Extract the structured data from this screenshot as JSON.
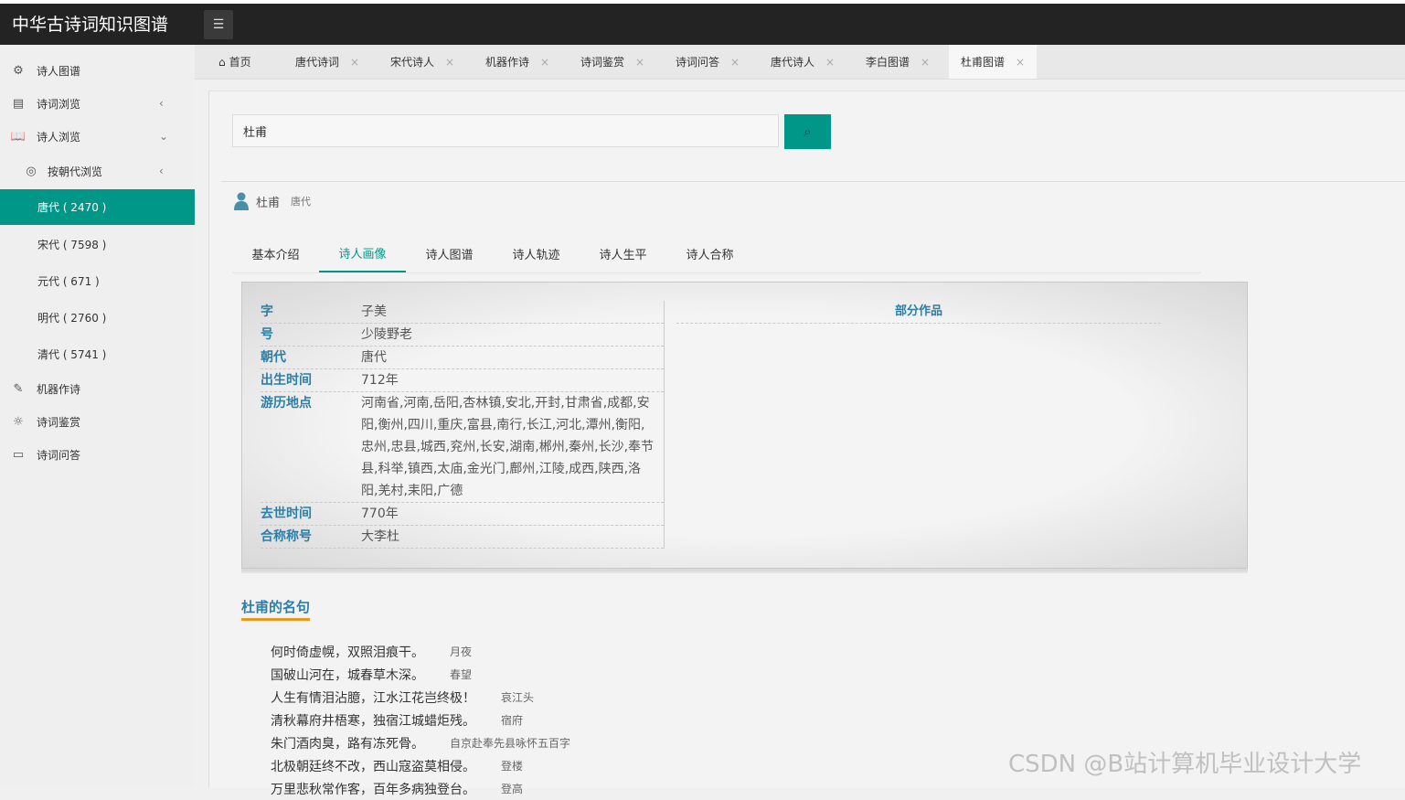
{
  "app": {
    "title": "中华古诗词知识图谱"
  },
  "icons": {
    "menu": "menu-icon",
    "search": "search-icon"
  },
  "sidebar": {
    "items": [
      {
        "label": "诗人图谱",
        "icon": "network-icon"
      },
      {
        "label": "诗词浏览",
        "icon": "document-icon",
        "chevron": "‹"
      },
      {
        "label": "诗人浏览",
        "icon": "book-icon",
        "chevron": "⌄"
      },
      {
        "label": "按朝代浏览",
        "icon": "user-circle-icon",
        "chevron": "‹"
      },
      {
        "label": "唐代 ( 2470 )",
        "active": true
      },
      {
        "label": "宋代 ( 7598 )"
      },
      {
        "label": "元代 ( 671 )"
      },
      {
        "label": "明代 ( 2760 )"
      },
      {
        "label": "清代 ( 5741 )"
      },
      {
        "label": "机器作诗",
        "icon": "pen-icon"
      },
      {
        "label": "诗词鉴赏",
        "icon": "lightbulb-icon"
      },
      {
        "label": "诗词问答",
        "icon": "chat-icon"
      }
    ]
  },
  "tabs": [
    {
      "label": "首页",
      "home": true
    },
    {
      "label": "唐代诗词",
      "close": "×"
    },
    {
      "label": "宋代诗人",
      "close": "×"
    },
    {
      "label": "机器作诗",
      "close": "×"
    },
    {
      "label": "诗词鉴赏",
      "close": "×"
    },
    {
      "label": "诗词问答",
      "close": "×"
    },
    {
      "label": "唐代诗人",
      "close": "×"
    },
    {
      "label": "李白图谱",
      "close": "×"
    },
    {
      "label": "杜甫图谱",
      "close": "×",
      "active": true
    }
  ],
  "search": {
    "value": "杜甫"
  },
  "poet": {
    "name": "杜甫",
    "dynasty": "唐代"
  },
  "poet_tabs": [
    {
      "label": "基本介绍"
    },
    {
      "label": "诗人画像",
      "active": true
    },
    {
      "label": "诗人图谱"
    },
    {
      "label": "诗人轨迹"
    },
    {
      "label": "诗人生平"
    },
    {
      "label": "诗人合称"
    }
  ],
  "info": [
    {
      "key": "字",
      "value": "子美"
    },
    {
      "key": "号",
      "value": "少陵野老"
    },
    {
      "key": "朝代",
      "value": "唐代"
    },
    {
      "key": "出生时间",
      "value": "712年"
    },
    {
      "key": "游历地点",
      "value": "河南省,河南,岳阳,杏林镇,安北,开封,甘肃省,成都,安阳,衡州,四川,重庆,富县,南行,长江,河北,潭州,衡阳,忠州,忠县,城西,兖州,长安,湖南,郴州,秦州,长沙,奉节县,科举,镇西,太庙,金光门,鄜州,江陵,成西,陕西,洛阳,羌村,耒阳,广德"
    },
    {
      "key": "去世时间",
      "value": "770年"
    },
    {
      "key": "合称称号",
      "value": "大李杜"
    }
  ],
  "works_title": "部分作品",
  "quotes_title": "杜甫的名句",
  "quotes": [
    {
      "text": "何时倚虚幌，双照泪痕干。",
      "source": "月夜"
    },
    {
      "text": "国破山河在，城春草木深。",
      "source": "春望"
    },
    {
      "text": "人生有情泪沾臆，江水江花岂终极！",
      "source": "哀江头"
    },
    {
      "text": "清秋幕府井梧寒，独宿江城蜡炬残。",
      "source": "宿府"
    },
    {
      "text": "朱门酒肉臭，路有冻死骨。",
      "source": "自京赴奉先县咏怀五百字"
    },
    {
      "text": "北极朝廷终不改，西山寇盗莫相侵。",
      "source": "登楼"
    },
    {
      "text": "万里悲秋常作客，百年多病独登台。",
      "source": "登高"
    }
  ],
  "watermark": "CSDN @B站计算机毕业设计大学"
}
